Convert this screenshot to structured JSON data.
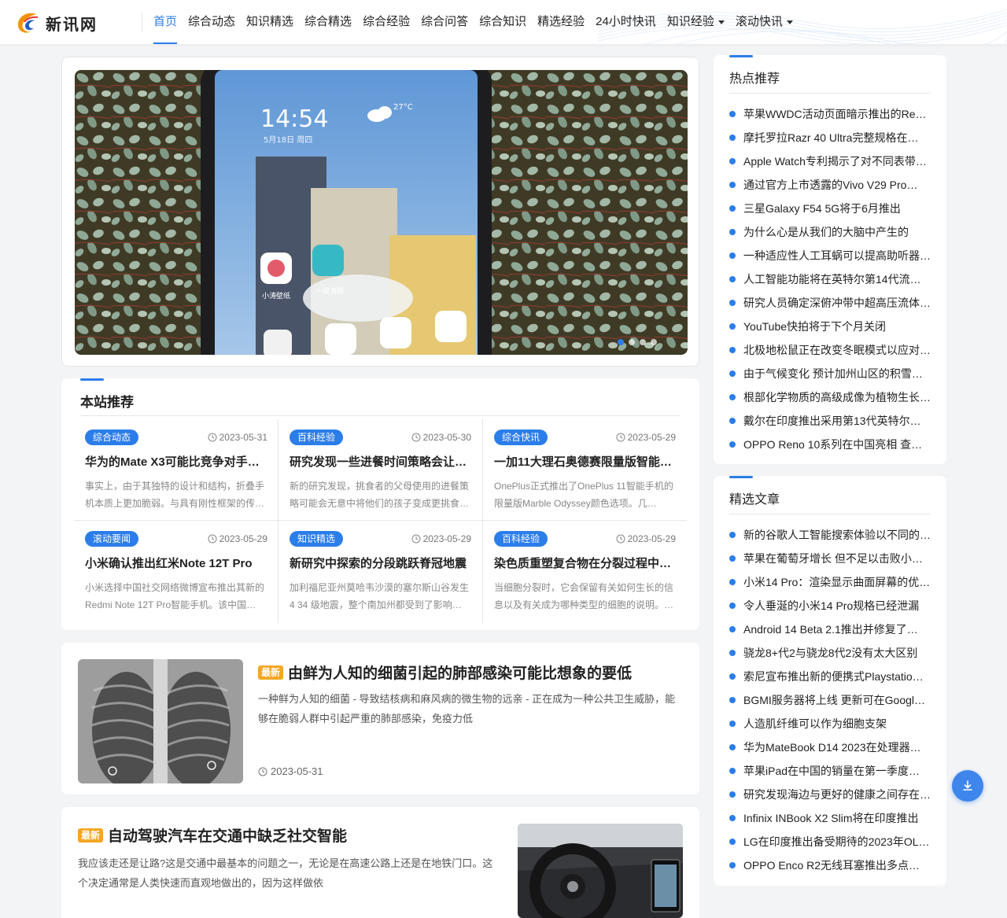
{
  "header": {
    "logo_text": "新讯网",
    "nav": [
      {
        "label": "首页",
        "active": true
      },
      {
        "label": "综合动态"
      },
      {
        "label": "知识精选"
      },
      {
        "label": "综合精选"
      },
      {
        "label": "综合经验"
      },
      {
        "label": "综合问答"
      },
      {
        "label": "综合知识"
      },
      {
        "label": "精选经验"
      },
      {
        "label": "24小时快讯"
      },
      {
        "label": "知识经验",
        "dropdown": true
      },
      {
        "label": "滚动快讯",
        "dropdown": true
      }
    ]
  },
  "carousel": {
    "slides": 4,
    "active_slide": 1,
    "phone_clock": "14:54",
    "phone_date": "5月18日 周四",
    "phone_temp": "27°C",
    "app_labels": [
      "小涛壁纸",
      "一键清理"
    ]
  },
  "recommend": {
    "title": "本站推荐",
    "items": [
      {
        "tag": "综合动态",
        "date": "2023-05-31",
        "title": "华为的Mate X3可能比竞争对手…",
        "desc": "事实上，由于其独特的设计和结构，折叠手机本质上更加脆弱。与具有刚性框架的传…"
      },
      {
        "tag": "百科经验",
        "date": "2023-05-30",
        "title": "研究发现一些进餐时间策略会让…",
        "desc": "新的研究发现，挑食者的父母使用的进餐策略可能会无意中将他们的孩子变成更挑食…"
      },
      {
        "tag": "综合快讯",
        "date": "2023-05-29",
        "title": "一加11大理石奥德赛限量版智能…",
        "desc": "OnePlus正式推出了OnePlus 11智能手机的限量版Marble Odyssey颜色选项。几…"
      },
      {
        "tag": "滚动要闻",
        "date": "2023-05-29",
        "title": "小米确认推出红米Note 12T Pro",
        "desc": "小米选择中国社交网络微博宣布推出其新的Redmi Note 12T Pro智能手机。该中国…"
      },
      {
        "tag": "知识精选",
        "date": "2023-05-29",
        "title": "新研究中探索的分段跳跃脊冠地震",
        "desc": "加利福尼亚州莫哈韦沙漠的塞尔斯山谷发生 4 34 级地震，整个南加州都受到了影响…"
      },
      {
        "tag": "百科经验",
        "date": "2023-05-29",
        "title": "染色质重塑复合物在分裂过程中…",
        "desc": "当细胞分裂时，它会保留有关如何生长的信息以及有关成为哪种类型的细胞的说明。…"
      }
    ]
  },
  "articles": [
    {
      "badge": "最新",
      "title": "由鲜为人知的细菌引起的肺部感染可能比想象的要低",
      "desc": "一种鲜为人知的细菌 - 导致结核病和麻风病的微生物的远亲 - 正在成为一种公共卫生威胁，能够在脆弱人群中引起严重的肺部感染，免疫力低",
      "date": "2023-05-31"
    },
    {
      "badge": "最新",
      "title": "自动驾驶汽车在交通中缺乏社交智能",
      "desc": "我应该走还是让路?这是交通中最基本的问题之一，无论是在高速公路上还是在地铁门口。这个决定通常是人类快速而直观地做出的，因为这样做依"
    }
  ],
  "sidebar": {
    "hot": {
      "title": "热点推荐",
      "items": [
        "苹果WWDC活动页面暗示推出的Re…",
        "摩托罗拉Razr 40 Ultra完整规格在…",
        "Apple Watch专利揭示了对不同表带…",
        "通过官方上市透露的Vivo V29 Pro…",
        "三星Galaxy F54 5G将于6月推出",
        "为什么心是从我们的大脑中产生的",
        "一种适应性人工耳蜗可以提高助听器…",
        "人工智能功能将在英特尔第14代流…",
        "研究人员确定深俯冲带中超高压流体…",
        "YouTube快拍将于下个月关闭",
        "北极地松鼠正在改变冬眠模式以应对…",
        "由于气候变化 预计加州山区的积雪…",
        "根部化学物质的高级成像为植物生长…",
        "戴尔在印度推出采用第13代英特尔…",
        "OPPO Reno 10系列在中国亮相 查…"
      ]
    },
    "featured": {
      "title": "精选文章",
      "items": [
        "新的谷歌人工智能搜索体验以不同的…",
        "苹果在葡萄牙增长 但不足以击败小…",
        "小米14 Pro：渲染显示曲面屏幕的优…",
        "令人垂涎的小米14 Pro规格已经泄漏",
        "Android 14 Beta 2.1推出并修复了…",
        "骁龙8+代2与骁龙8代2没有太大区别",
        "索尼宣布推出新的便携式Playstatio…",
        "BGMI服务器将上线 更新可在Googl…",
        "人造肌纤维可以作为细胞支架",
        "华为MateBook D14 2023在处理器…",
        "苹果iPad在中国的销量在第一季度翻…",
        "研究发现海边与更好的健康之间存在…",
        "Infinix INBook X2 Slim将在印度推出",
        "LG在印度推出备受期待的2023年OL…",
        "OPPO Enco R2无线耳塞推出多点连…"
      ]
    }
  },
  "colors": {
    "accent": "#2b7de9",
    "badge_new": "#f5a623"
  },
  "icons": {
    "clock": "clock-icon",
    "download": "download-icon",
    "caret": "chevron-down-icon"
  }
}
